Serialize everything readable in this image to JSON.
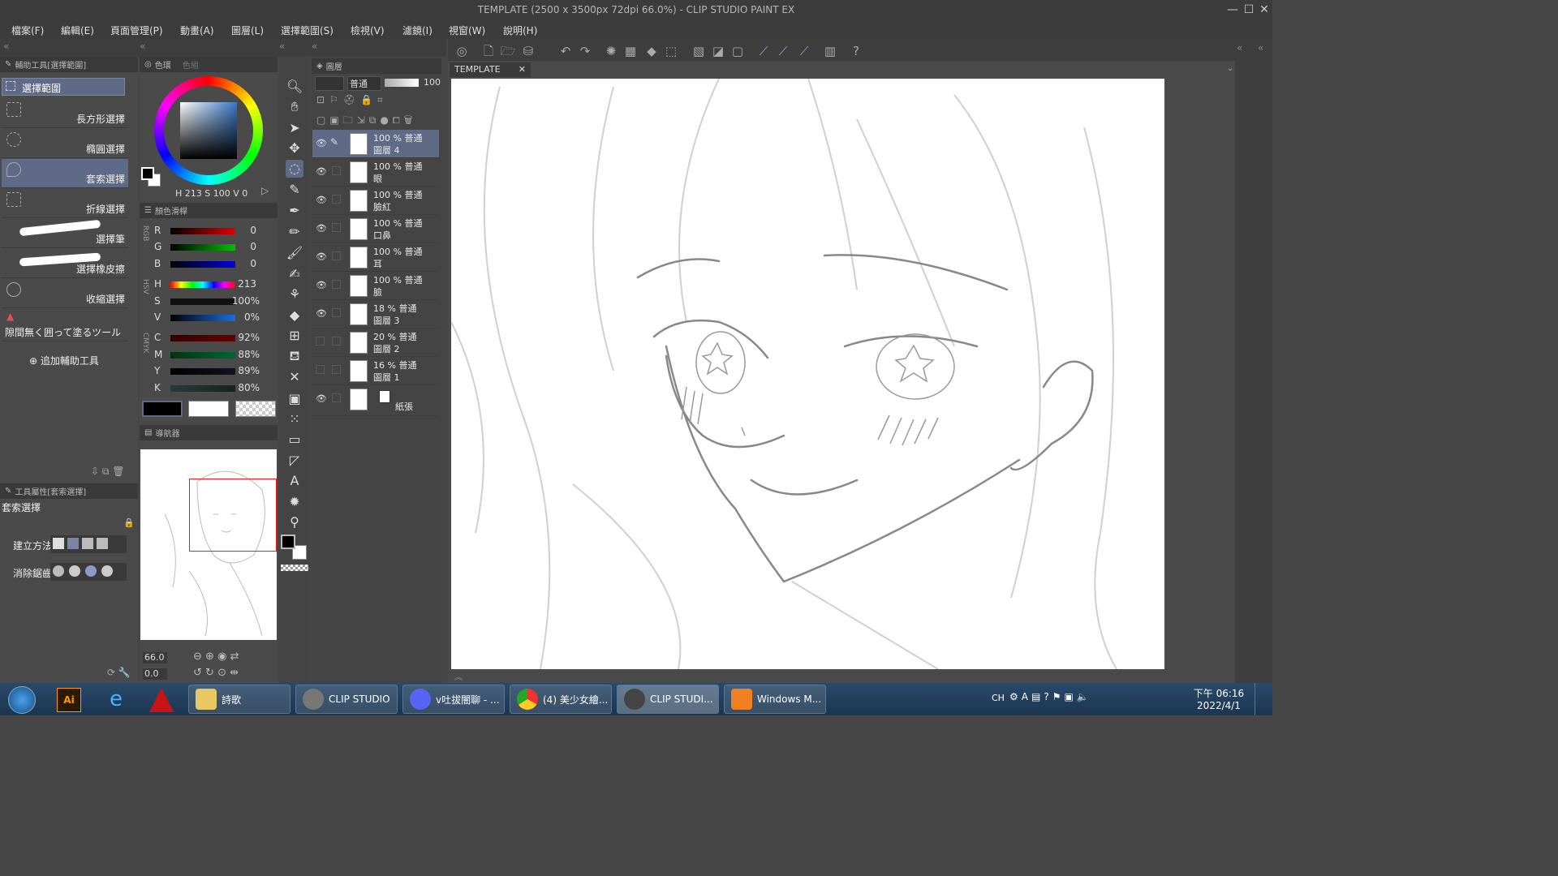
{
  "window": {
    "title": "TEMPLATE (2500 x 3500px 72dpi 66.0%) - CLIP STUDIO PAINT EX",
    "minimize": "—",
    "maximize": "☐",
    "close": "✕"
  },
  "menu": [
    "檔案(F)",
    "編輯(E)",
    "頁面管理(P)",
    "動畫(A)",
    "圖層(L)",
    "選擇範圍(S)",
    "檢視(V)",
    "濾鏡(I)",
    "視窗(W)",
    "說明(H)"
  ],
  "subtool": {
    "header": "輔助工具[選擇範圍]",
    "group": "選擇範圍",
    "items": [
      "長方形選擇",
      "橢圓選擇",
      "套索選擇",
      "折線選擇",
      "選擇筆",
      "選擇橡皮擦",
      "收縮選擇",
      "隙間無く囲って塗るツール"
    ],
    "selected_index": 2,
    "add": "追加輔助工具"
  },
  "toolprop": {
    "header": "工具屬性[套索選擇]",
    "name": "套索選擇",
    "method_label": "建立方法",
    "aa_label": "消除鋸齒"
  },
  "color": {
    "tab_wheel": "色環",
    "tab_set": "色組",
    "hsv": "H 213 S 100 V  0",
    "main": "#000000",
    "sub": "#ffffff",
    "ring_hue": "#3a78c8"
  },
  "sliders": {
    "tab": "顏色滑桿",
    "rgb_label": "RGB",
    "hsv_label": "HSV",
    "cmyk_label": "CMYK",
    "items": [
      {
        "k": "R",
        "v": "0"
      },
      {
        "k": "G",
        "v": "0"
      },
      {
        "k": "B",
        "v": "0"
      },
      {
        "k": "H",
        "v": "213"
      },
      {
        "k": "S",
        "v": "100%"
      },
      {
        "k": "V",
        "v": "0%"
      },
      {
        "k": "C",
        "v": "92%"
      },
      {
        "k": "M",
        "v": "88%"
      },
      {
        "k": "Y",
        "v": "89%"
      },
      {
        "k": "K",
        "v": "80%"
      }
    ]
  },
  "navigator": {
    "tab": "導航器",
    "zoom": "66.0",
    "angle": "0.0"
  },
  "layerpanel": {
    "tab": "圖層",
    "blend": "普通",
    "opacity": "100"
  },
  "layers": [
    {
      "line1": "100 % 普通",
      "line2": "圖層 4",
      "selected": true,
      "pen": "✎"
    },
    {
      "line1": "100 % 普通",
      "line2": "眼"
    },
    {
      "line1": "100 % 普通",
      "line2": "臉紅"
    },
    {
      "line1": "100 % 普通",
      "line2": "口鼻"
    },
    {
      "line1": "100 % 普通",
      "line2": "耳"
    },
    {
      "line1": "100 % 普通",
      "line2": "臉"
    },
    {
      "line1": "18 % 普通",
      "line2": "圖層 3"
    },
    {
      "line1": "20 % 普通",
      "line2": "圖層 2"
    },
    {
      "line1": "16 % 普通",
      "line2": "圖層 1"
    },
    {
      "line1": "",
      "line2": "紙張"
    }
  ],
  "canvas": {
    "tab": "TEMPLATE"
  },
  "taskbar": {
    "apps": [
      "詩歌",
      "CLIP STUDIO",
      "v吐拔闇聊 - ...",
      "(4) 美少女繪...",
      "CLIP STUDI...",
      "Windows M..."
    ],
    "lang": "CH",
    "time": "下午 06:16",
    "date": "2022/4/1"
  }
}
